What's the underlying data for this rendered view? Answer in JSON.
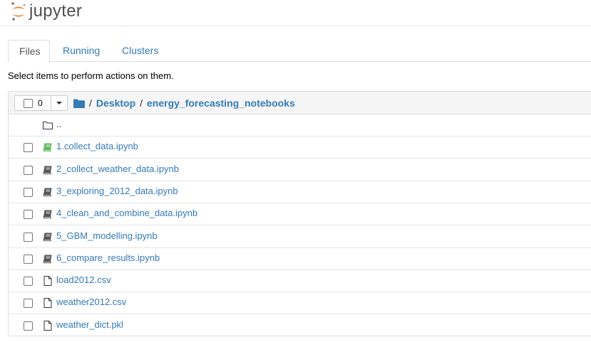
{
  "header": {
    "logo_text": "jupyter"
  },
  "tabs": [
    {
      "label": "Files",
      "active": true
    },
    {
      "label": "Running",
      "active": false
    },
    {
      "label": "Clusters",
      "active": false
    }
  ],
  "hint": "Select items to perform actions on them.",
  "toolbar": {
    "selected_count": "0"
  },
  "breadcrumb": {
    "separator": "/",
    "items": [
      "Desktop",
      "energy_forecasting_notebooks"
    ]
  },
  "files": [
    {
      "name": "..",
      "type": "parent",
      "has_checkbox": false
    },
    {
      "name": "1.collect_data.ipynb",
      "type": "notebook-running",
      "has_checkbox": true
    },
    {
      "name": "2_collect_weather_data.ipynb",
      "type": "notebook",
      "has_checkbox": true
    },
    {
      "name": "3_exploring_2012_data.ipynb",
      "type": "notebook",
      "has_checkbox": true
    },
    {
      "name": "4_clean_and_combine_data.ipynb",
      "type": "notebook",
      "has_checkbox": true
    },
    {
      "name": "5_GBM_modelling.ipynb",
      "type": "notebook",
      "has_checkbox": true
    },
    {
      "name": "6_compare_results.ipynb",
      "type": "notebook",
      "has_checkbox": true
    },
    {
      "name": "load2012.csv",
      "type": "file",
      "has_checkbox": true
    },
    {
      "name": "weather2012.csv",
      "type": "file",
      "has_checkbox": true
    },
    {
      "name": "weather_dict.pkl",
      "type": "file",
      "has_checkbox": true
    }
  ],
  "colors": {
    "link": "#337ab7",
    "running_notebook": "#5cb85c",
    "notebook_icon": "#555555",
    "logo_orange": "#f37726"
  },
  "icons": {
    "parent": "folder-icon",
    "notebook": "book-icon",
    "file": "file-icon",
    "breadcrumb_root": "folder-icon"
  }
}
